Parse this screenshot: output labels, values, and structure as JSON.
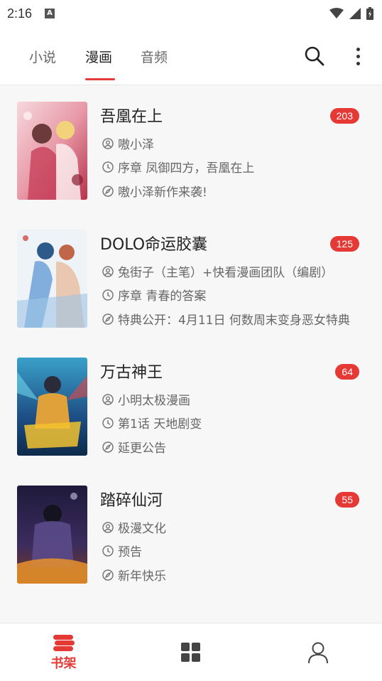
{
  "status_bar": {
    "time": "2:16",
    "notification_icon": "A"
  },
  "tabs": [
    {
      "label": "小说",
      "active": false
    },
    {
      "label": "漫画",
      "active": true
    },
    {
      "label": "音频",
      "active": false
    }
  ],
  "colors": {
    "accent": "#e53935",
    "badge": "#e53935"
  },
  "comics": [
    {
      "title": "吾凰在上",
      "badge": "203",
      "author": "嗷小泽",
      "chapter": "序章 凤御四方，吾凰在上",
      "notice": "嗷小泽新作来袭!"
    },
    {
      "title": "DOLO命运胶囊",
      "badge": "125",
      "author": "兔街子（主笔）+快看漫画团队（编剧）",
      "chapter": "序章 青春的答案",
      "notice": "特典公开：4月11日 何数周末变身恶女特典"
    },
    {
      "title": "万古神王",
      "badge": "64",
      "author": "小明太极漫画",
      "chapter": "第1话 天地剧变",
      "notice": "延更公告"
    },
    {
      "title": "踏碎仙河",
      "badge": "55",
      "author": "极漫文化",
      "chapter": "预告",
      "notice": "新年快乐"
    }
  ],
  "bottom_nav": [
    {
      "label": "书架",
      "icon": "bookshelf-icon",
      "active": true
    },
    {
      "label": "",
      "icon": "category-grid-icon",
      "active": false
    },
    {
      "label": "",
      "icon": "person-icon",
      "active": false
    }
  ]
}
